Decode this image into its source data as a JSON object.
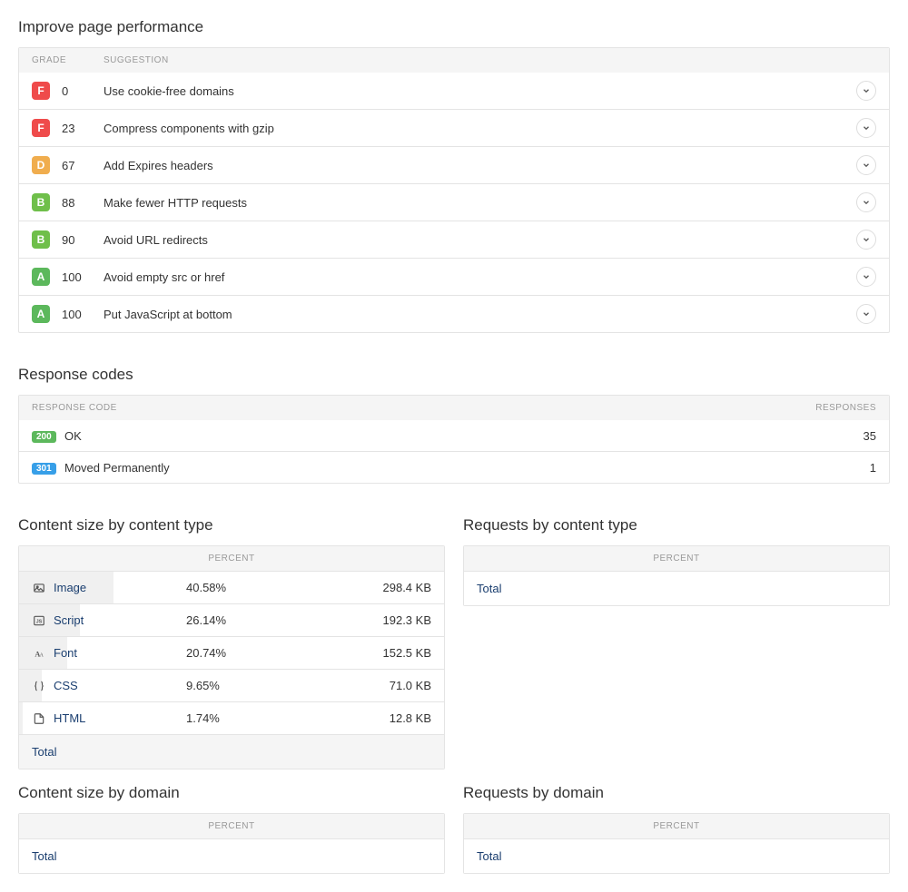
{
  "performance": {
    "title": "Improve page performance",
    "headers": {
      "grade": "GRADE",
      "suggestion": "SUGGESTION"
    },
    "grade_colors": {
      "F": "#ef4b4b",
      "D": "#f0ad4e",
      "B": "#6fbf4a",
      "A": "#5cb85c"
    },
    "rows": [
      {
        "grade": "F",
        "score": "0",
        "suggestion": "Use cookie-free domains"
      },
      {
        "grade": "F",
        "score": "23",
        "suggestion": "Compress components with gzip"
      },
      {
        "grade": "D",
        "score": "67",
        "suggestion": "Add Expires headers"
      },
      {
        "grade": "B",
        "score": "88",
        "suggestion": "Make fewer HTTP requests"
      },
      {
        "grade": "B",
        "score": "90",
        "suggestion": "Avoid URL redirects"
      },
      {
        "grade": "A",
        "score": "100",
        "suggestion": "Avoid empty src or href"
      },
      {
        "grade": "A",
        "score": "100",
        "suggestion": "Put JavaScript at bottom"
      }
    ]
  },
  "response_codes": {
    "title": "Response codes",
    "headers": {
      "code": "RESPONSE CODE",
      "responses": "RESPONSES"
    },
    "code_colors": {
      "200": "#5cb85c",
      "301": "#379fe8"
    },
    "rows": [
      {
        "code": "200",
        "label": "OK",
        "count": "35"
      },
      {
        "code": "301",
        "label": "Moved Permanently",
        "count": "1"
      }
    ]
  },
  "content_size_type": {
    "title": "Content size by content type",
    "header_percent": "PERCENT",
    "rows": [
      {
        "icon": "image-icon",
        "type": "Image",
        "percent": "40.58%",
        "size": "298.4 KB",
        "bar": 40.58
      },
      {
        "icon": "script-icon",
        "type": "Script",
        "percent": "26.14%",
        "size": "192.3 KB",
        "bar": 26.14
      },
      {
        "icon": "font-icon",
        "type": "Font",
        "percent": "20.74%",
        "size": "152.5 KB",
        "bar": 20.74
      },
      {
        "icon": "css-icon",
        "type": "CSS",
        "percent": "9.65%",
        "size": "71.0 KB",
        "bar": 9.65
      },
      {
        "icon": "html-icon",
        "type": "HTML",
        "percent": "1.74%",
        "size": "12.8 KB",
        "bar": 1.74
      }
    ],
    "total_label": "Total"
  },
  "requests_type": {
    "title": "Requests by content type",
    "header_percent": "PERCENT",
    "total_label": "Total"
  },
  "content_size_domain": {
    "title": "Content size by domain",
    "header_percent": "PERCENT",
    "total_label": "Total"
  },
  "requests_domain": {
    "title": "Requests by domain",
    "header_percent": "PERCENT",
    "total_label": "Total"
  }
}
